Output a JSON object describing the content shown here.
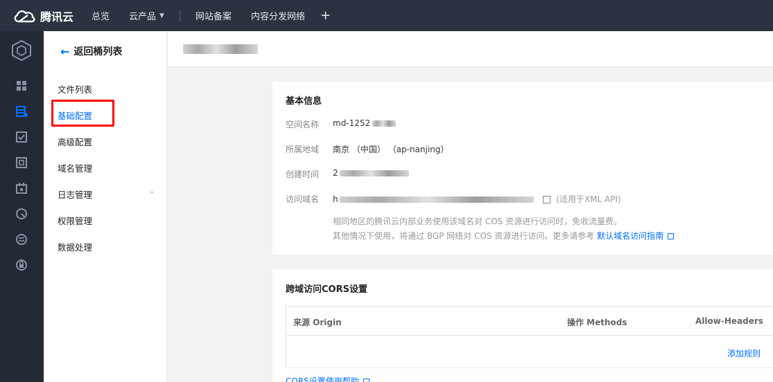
{
  "topnav": {
    "brand": "腾讯云",
    "items": [
      {
        "label": "总览"
      },
      {
        "label": "云产品",
        "has_caret": true
      },
      {
        "label": "网站备案"
      },
      {
        "label": "内容分发网络"
      }
    ],
    "plus": "+"
  },
  "sidemenu": {
    "back_label": "返回桶列表",
    "items": [
      {
        "label": "文件列表"
      },
      {
        "label": "基础配置",
        "active": true
      },
      {
        "label": "高级配置"
      },
      {
        "label": "域名管理"
      },
      {
        "label": "日志管理",
        "expandable": true
      },
      {
        "label": "权限管理"
      },
      {
        "label": "数据处理"
      }
    ]
  },
  "basic_info": {
    "title": "基本信息",
    "bucket_name_label": "空间名称",
    "bucket_name_value": "md-1252",
    "region_label": "所属地域",
    "region_value": "南京 （中国） （ap-nanjing）",
    "created_label": "创建时间",
    "created_value": "2",
    "domain_label": "访问域名",
    "domain_value": "h",
    "domain_note": "(适用于XML API)",
    "hint_line1": "相同地区的腾讯云内部业务使用该域名对 COS 资源进行访问时，免收流量费。",
    "hint_line2": "其他情况下使用，将通过 BGP 网络对 COS 资源进行访问。更多请参考",
    "hint_link": "默认域名访问指南"
  },
  "cors": {
    "title": "跨域访问CORS设置",
    "columns": [
      "来源 Origin",
      "操作 Methods",
      "Allow-Headers"
    ],
    "add_rule": "添加规则",
    "help_link": "CORS设置使用帮助"
  },
  "colors": {
    "topnav_bg": "#2b3341",
    "rail_bg": "#242a35",
    "accent": "#006eff",
    "highlight_box": "#ff0000"
  }
}
